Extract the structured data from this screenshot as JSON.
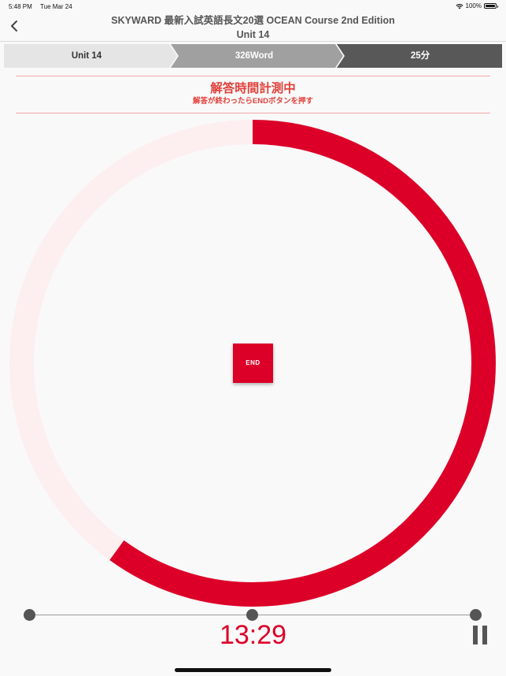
{
  "status_bar": {
    "time": "5:48 PM",
    "date": "Tue Mar 24",
    "battery_percent": "100%",
    "battery_level": 1.0
  },
  "nav": {
    "title_line1": "SKYWARD 最新入試英語長文20選  OCEAN Course 2nd Edition",
    "title_line2": "Unit 14"
  },
  "steps": [
    {
      "label": "Unit 14",
      "color": "#e5e5e5"
    },
    {
      "label": "326Word",
      "color": "#a0a0a0"
    },
    {
      "label": "25分",
      "color": "#585858"
    }
  ],
  "banner": {
    "title": "解答時間計測中",
    "subtitle": "解答が終わったらENDボタンを押す"
  },
  "timer": {
    "remaining_fraction": 0.6,
    "ring_color": "#dc0028",
    "track_color": "#fdeef0",
    "end_label": "END",
    "time_display": "13:29"
  },
  "colors": {
    "accent": "#dc0028",
    "banner_text": "#e0413c"
  }
}
